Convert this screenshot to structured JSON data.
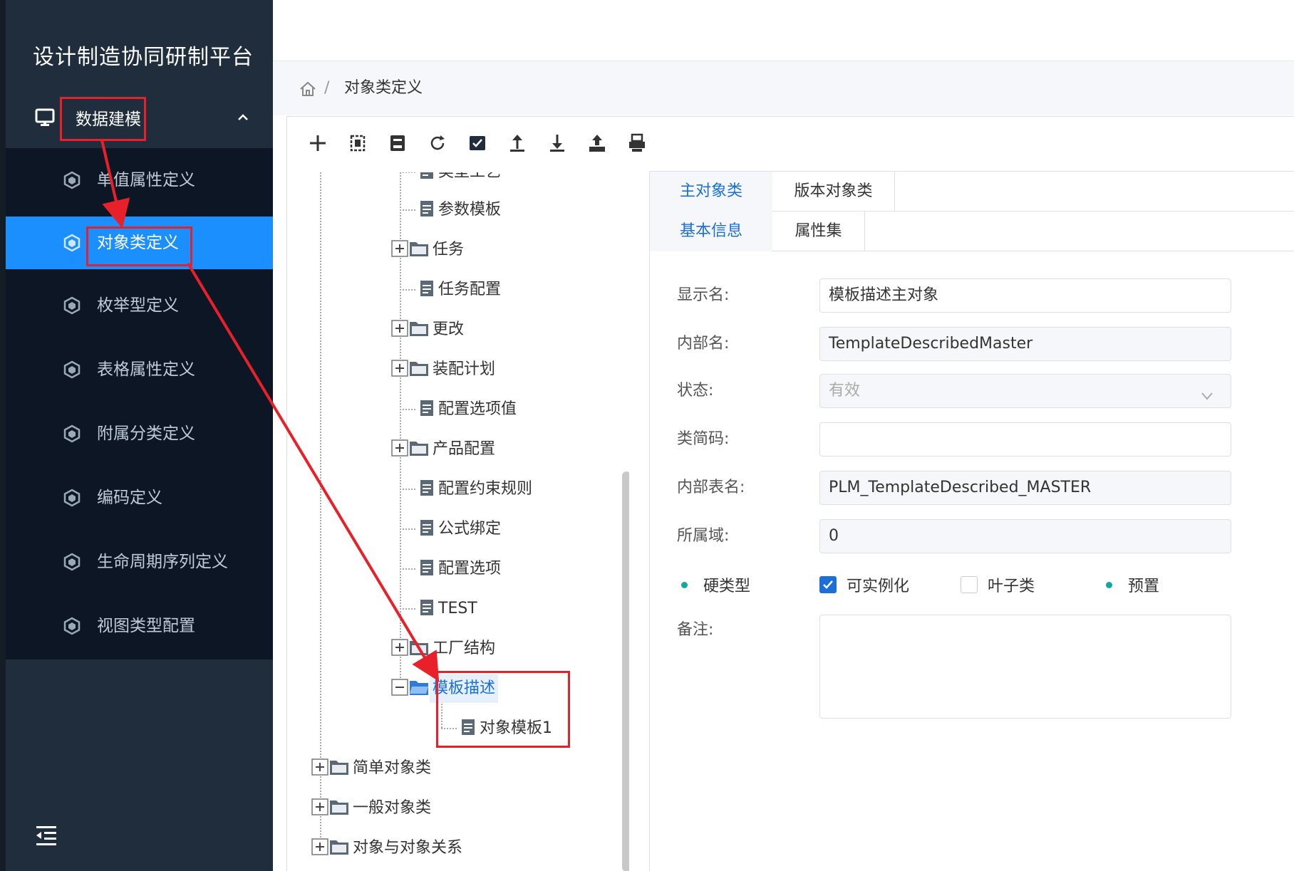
{
  "app": {
    "title": "设计制造协同研制平台"
  },
  "sidebar": {
    "group_label": "数据建模",
    "items": [
      {
        "label": "单值属性定义"
      },
      {
        "label": "对象类定义"
      },
      {
        "label": "枚举型定义"
      },
      {
        "label": "表格属性定义"
      },
      {
        "label": "附属分类定义"
      },
      {
        "label": "编码定义"
      },
      {
        "label": "生命周期序列定义"
      },
      {
        "label": "视图类型配置"
      }
    ],
    "active_index": 1
  },
  "breadcrumb": {
    "separator": "/",
    "current": "对象类定义"
  },
  "toolbar": {
    "buttons": [
      "add-icon",
      "copy-icon",
      "save-icon",
      "refresh-icon",
      "check-icon",
      "upload-icon",
      "download-icon",
      "export-icon",
      "print-icon"
    ]
  },
  "tree": {
    "nodes": [
      {
        "label": "类型工艺",
        "kind": "file"
      },
      {
        "label": "参数模板",
        "kind": "file"
      },
      {
        "label": "任务",
        "kind": "folder"
      },
      {
        "label": "任务配置",
        "kind": "file"
      },
      {
        "label": "更改",
        "kind": "folder"
      },
      {
        "label": "装配计划",
        "kind": "folder"
      },
      {
        "label": "配置选项值",
        "kind": "file"
      },
      {
        "label": "产品配置",
        "kind": "folder"
      },
      {
        "label": "配置约束规则",
        "kind": "file"
      },
      {
        "label": "公式绑定",
        "kind": "file"
      },
      {
        "label": "配置选项",
        "kind": "file"
      },
      {
        "label": "TEST",
        "kind": "file"
      },
      {
        "label": "工厂结构",
        "kind": "folder"
      },
      {
        "label": "模板描述",
        "kind": "folder-open"
      },
      {
        "label": "对象模板1",
        "kind": "file"
      },
      {
        "label": "简单对象类",
        "kind": "folder"
      },
      {
        "label": "一般对象类",
        "kind": "folder"
      },
      {
        "label": "对象与对象关系",
        "kind": "folder"
      }
    ],
    "selected": "模板描述"
  },
  "tabs": {
    "level1": [
      {
        "label": "主对象类"
      },
      {
        "label": "版本对象类"
      }
    ],
    "level2": [
      {
        "label": "基本信息"
      },
      {
        "label": "属性集"
      }
    ]
  },
  "form": {
    "display_name": {
      "label": "显示名:",
      "value": "模板描述主对象"
    },
    "internal_name": {
      "label": "内部名:",
      "value": "TemplateDescribedMaster"
    },
    "status": {
      "label": "状态:",
      "value": "有效"
    },
    "class_code": {
      "label": "类简码:",
      "value": ""
    },
    "table_name": {
      "label": "内部表名:",
      "value": "PLM_TemplateDescribed_MASTER"
    },
    "domain": {
      "label": "所属域:",
      "value": "0"
    },
    "flags": [
      {
        "label": "硬类型",
        "kind": "dot"
      },
      {
        "label": "可实例化",
        "kind": "checkbox",
        "checked": true
      },
      {
        "label": "叶子类",
        "kind": "checkbox",
        "checked": false
      },
      {
        "label": "预置",
        "kind": "dot"
      }
    ],
    "notes": {
      "label": "备注:",
      "value": ""
    }
  },
  "colors": {
    "sidebar_bg": "#1f2d3d",
    "submenu_bg": "#0c1624",
    "active": "#1c8fff",
    "accent": "#1c6fd6",
    "annotation": "#e8202a"
  }
}
